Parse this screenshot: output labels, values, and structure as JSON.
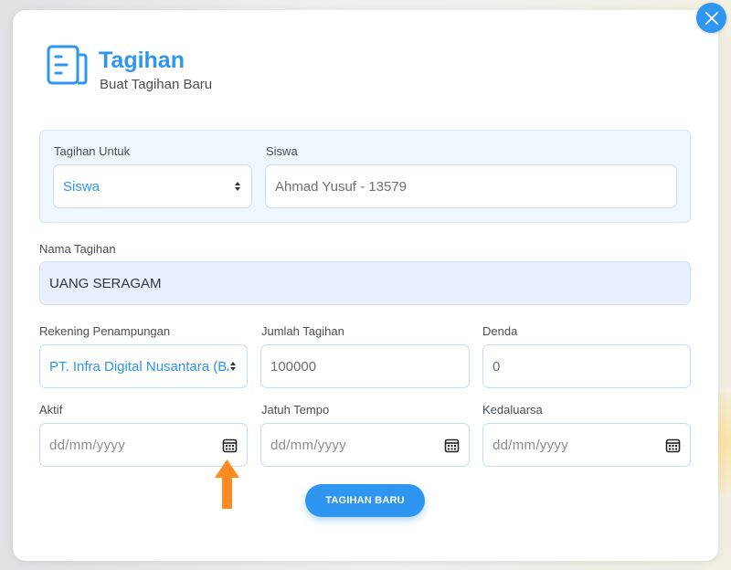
{
  "header": {
    "title": "Tagihan",
    "subtitle": "Buat Tagihan Baru",
    "icon": "document-icon"
  },
  "form": {
    "tagihan_untuk": {
      "label": "Tagihan Untuk",
      "value": "Siswa"
    },
    "siswa": {
      "label": "Siswa",
      "value": "Ahmad Yusuf - 13579"
    },
    "nama_tagihan": {
      "label": "Nama Tagihan",
      "value": "UANG SERAGAM"
    },
    "rekening": {
      "label": "Rekening Penampungan",
      "value": "PT. Infra Digital Nusantara (BA"
    },
    "jumlah": {
      "label": "Jumlah Tagihan",
      "value": "100000"
    },
    "denda": {
      "label": "Denda",
      "value": "0"
    },
    "aktif": {
      "label": "Aktif",
      "placeholder": "dd/mm/yyyy"
    },
    "jatuh_tempo": {
      "label": "Jatuh Tempo",
      "placeholder": "dd/mm/yyyy"
    },
    "kedaluarsa": {
      "label": "Kedaluarsa",
      "placeholder": "dd/mm/yyyy"
    }
  },
  "submit_label": "TAGIHAN BARU",
  "colors": {
    "accent": "#2e95f0",
    "annotation_arrow": "#ff8a1f",
    "panel_bg": "#eef6fe",
    "filled_input_bg": "#e8f0fd"
  }
}
